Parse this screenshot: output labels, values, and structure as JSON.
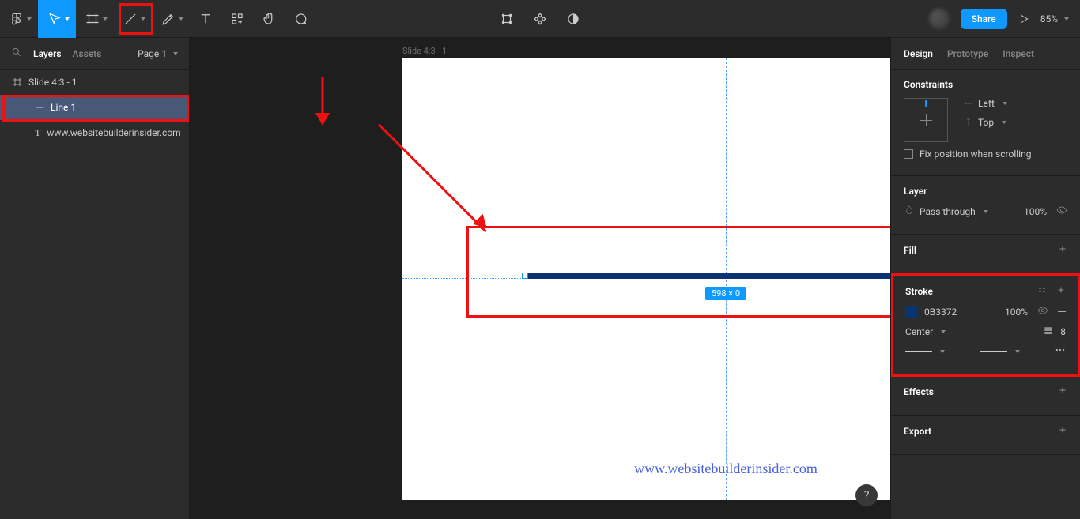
{
  "toolbar": {
    "share_label": "Share",
    "zoom": "85%"
  },
  "left_panel": {
    "tabs": {
      "layers": "Layers",
      "assets": "Assets"
    },
    "page_selector": "Page 1",
    "layers": [
      {
        "name": "Slide 4:3 - 1",
        "type": "frame",
        "level": 0
      },
      {
        "name": "Line 1",
        "type": "line",
        "level": 1,
        "selected": true
      },
      {
        "name": "www.websitebuilderinsider.com",
        "type": "text",
        "level": 1
      }
    ]
  },
  "canvas": {
    "frame_label": "Slide 4:3 - 1",
    "selection_size": "598 × 0",
    "watermark": "www.websitebuilderinsider.com"
  },
  "right_panel": {
    "tabs": {
      "design": "Design",
      "prototype": "Prototype",
      "inspect": "Inspect"
    },
    "constraints": {
      "title": "Constraints",
      "h": "Left",
      "v": "Top",
      "fix_label": "Fix position when scrolling"
    },
    "layer": {
      "title": "Layer",
      "blend": "Pass through",
      "opacity": "100%"
    },
    "fill": {
      "title": "Fill"
    },
    "stroke": {
      "title": "Stroke",
      "color_hex": "0B3372",
      "color_css": "#0b3372",
      "opacity": "100%",
      "align": "Center",
      "weight": "8"
    },
    "effects": {
      "title": "Effects"
    },
    "export": {
      "title": "Export"
    }
  },
  "help": "?"
}
